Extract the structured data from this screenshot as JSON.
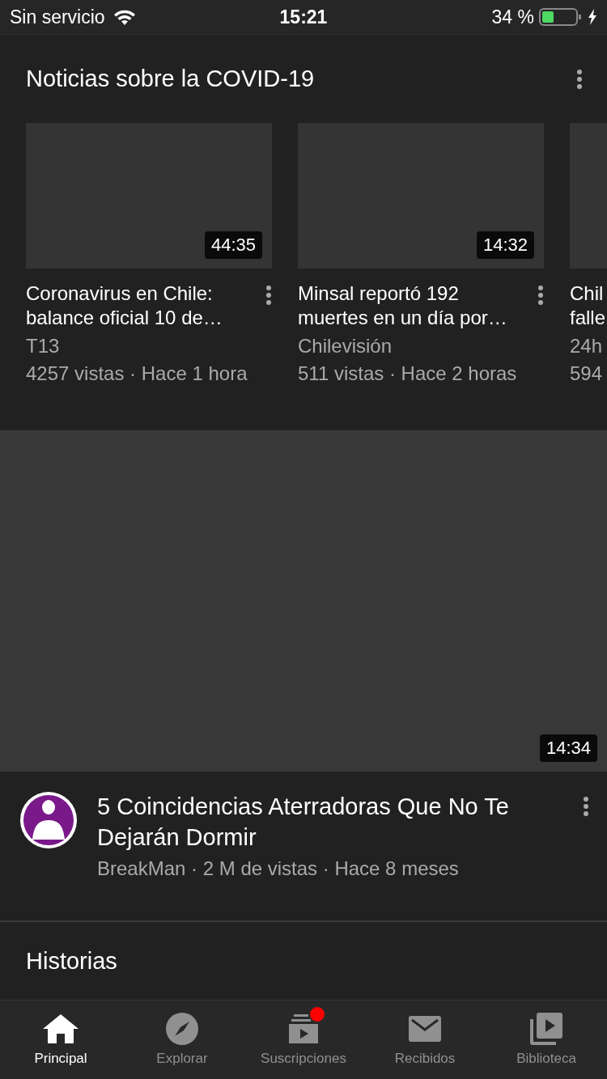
{
  "status_bar": {
    "carrier": "Sin servicio",
    "time": "15:21",
    "battery": "34 %"
  },
  "shelf": {
    "title": "Noticias sobre la COVID-19",
    "cards": [
      {
        "duration": "44:35",
        "title": "Coronavirus en Chile: balance oficial 10 de…",
        "channel": "T13",
        "meta": "4257 vistas · Hace 1 hora"
      },
      {
        "duration": "14:32",
        "title": "Minsal reportó 192 muertes en un día por…",
        "channel": "Chilevisión",
        "meta": "511 vistas · Hace 2 horas"
      },
      {
        "title_lines": [
          "Chil",
          "falle"
        ],
        "channel": "24h",
        "meta": "594"
      }
    ]
  },
  "video": {
    "duration": "14:34",
    "title": "5 Coincidencias Aterradoras Que No Te Dejarán Dormir",
    "meta": "BreakMan · 2 M de vistas · Hace 8 meses"
  },
  "stories": {
    "title": "Historias"
  },
  "tabs": [
    {
      "label": "Principal",
      "kind": "home",
      "selected": true,
      "badge": false
    },
    {
      "label": "Explorar",
      "kind": "explore",
      "selected": false,
      "badge": false
    },
    {
      "label": "Suscripciones",
      "kind": "subscriptions",
      "selected": false,
      "badge": true
    },
    {
      "label": "Recibidos",
      "kind": "inbox",
      "selected": false,
      "badge": false
    },
    {
      "label": "Biblioteca",
      "kind": "library",
      "selected": false,
      "badge": false
    }
  ]
}
